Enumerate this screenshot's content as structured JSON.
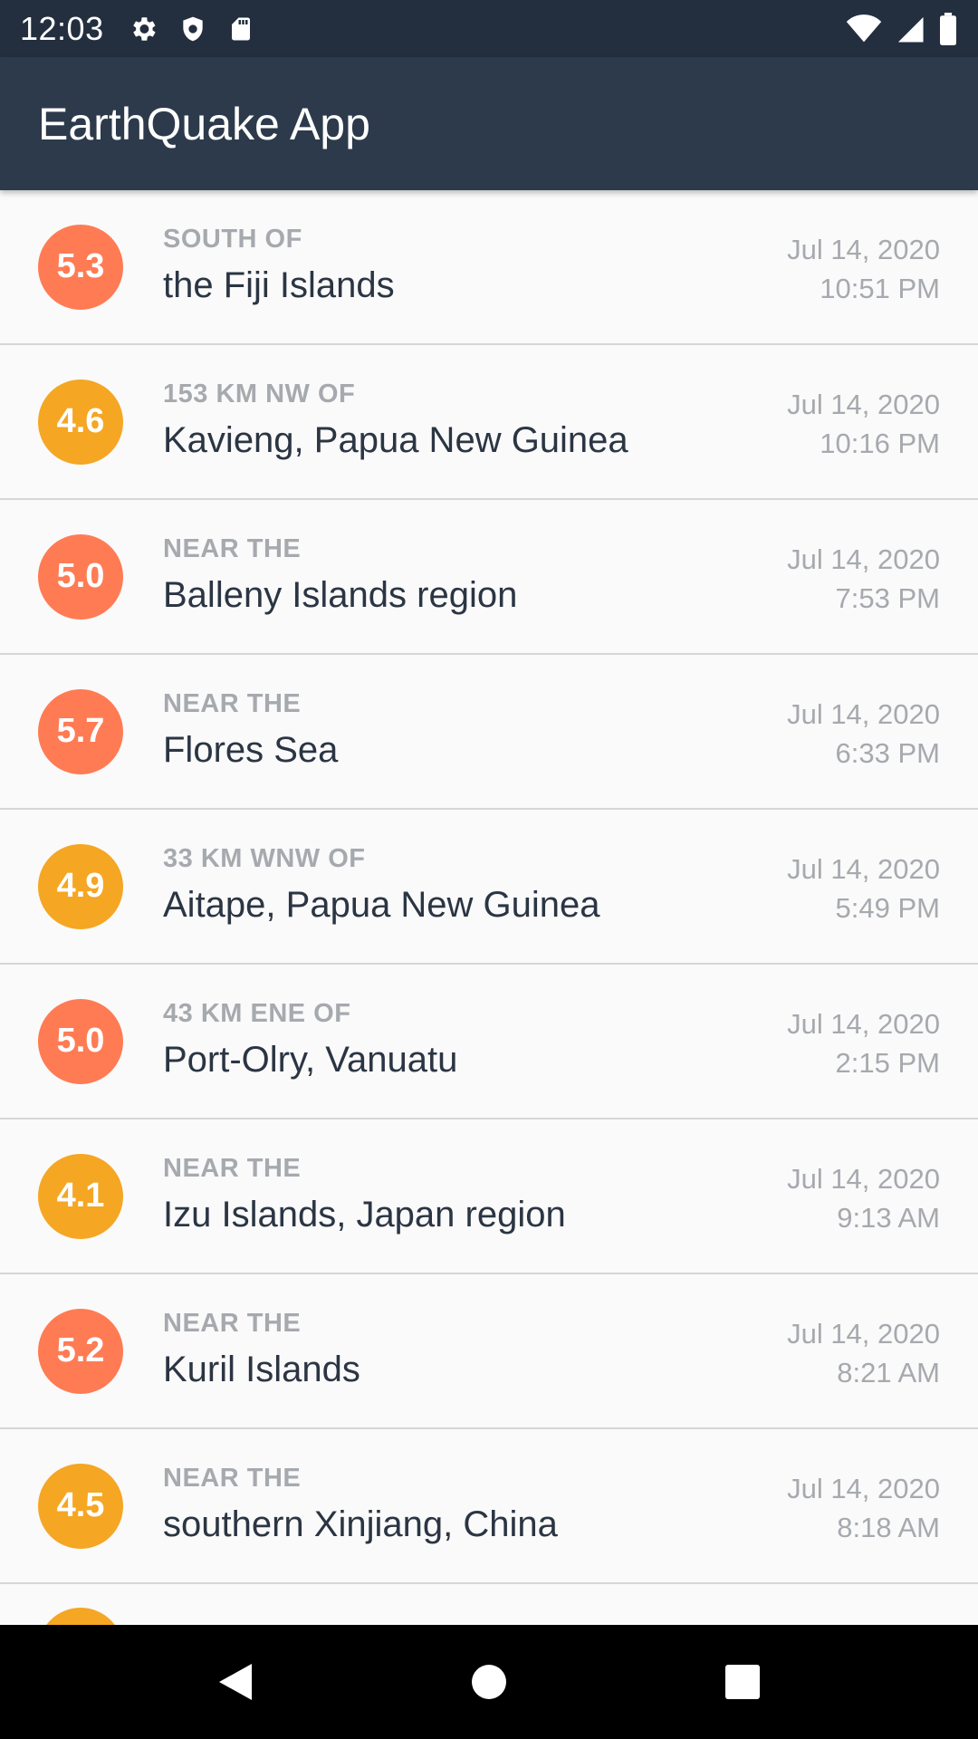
{
  "status_bar": {
    "time": "12:03",
    "left_icons": [
      "gear-icon",
      "shield-icon",
      "sd-card-icon"
    ],
    "right_icons": [
      "wifi-icon",
      "signal-icon",
      "battery-icon"
    ]
  },
  "app_bar": {
    "title": "EarthQuake App"
  },
  "colors": {
    "status_bar": "#232f3e",
    "app_bar": "#2d3a4b",
    "mag_high": "#ff7b54",
    "mag_mid": "#f5a623"
  },
  "quakes": [
    {
      "magnitude": "5.3",
      "mag_color": "#ff7b54",
      "offset": "SOUTH OF",
      "location": "the Fiji Islands",
      "date": "Jul 14, 2020",
      "time": "10:51 PM"
    },
    {
      "magnitude": "4.6",
      "mag_color": "#f5a623",
      "offset": "153 KM NW OF",
      "location": "Kavieng, Papua New Guinea",
      "date": "Jul 14, 2020",
      "time": "10:16 PM"
    },
    {
      "magnitude": "5.0",
      "mag_color": "#ff7b54",
      "offset": "NEAR THE",
      "location": "Balleny Islands region",
      "date": "Jul 14, 2020",
      "time": "7:53 PM"
    },
    {
      "magnitude": "5.7",
      "mag_color": "#ff7b54",
      "offset": "NEAR THE",
      "location": "Flores Sea",
      "date": "Jul 14, 2020",
      "time": "6:33 PM"
    },
    {
      "magnitude": "4.9",
      "mag_color": "#f5a623",
      "offset": "33 KM WNW OF",
      "location": "Aitape, Papua New Guinea",
      "date": "Jul 14, 2020",
      "time": "5:49 PM"
    },
    {
      "magnitude": "5.0",
      "mag_color": "#ff7b54",
      "offset": "43 KM ENE OF",
      "location": "Port-Olry, Vanuatu",
      "date": "Jul 14, 2020",
      "time": "2:15 PM"
    },
    {
      "magnitude": "4.1",
      "mag_color": "#f5a623",
      "offset": "NEAR THE",
      "location": "Izu Islands, Japan region",
      "date": "Jul 14, 2020",
      "time": "9:13 AM"
    },
    {
      "magnitude": "5.2",
      "mag_color": "#ff7b54",
      "offset": "NEAR THE",
      "location": "Kuril Islands",
      "date": "Jul 14, 2020",
      "time": "8:21 AM"
    },
    {
      "magnitude": "4.5",
      "mag_color": "#f5a623",
      "offset": "NEAR THE",
      "location": "southern Xinjiang, China",
      "date": "Jul 14, 2020",
      "time": "8:18 AM"
    }
  ],
  "partial_item": {
    "mag_color": "#f5a623"
  },
  "nav_bar": {
    "buttons": [
      "back-icon",
      "home-icon",
      "recents-icon"
    ]
  }
}
